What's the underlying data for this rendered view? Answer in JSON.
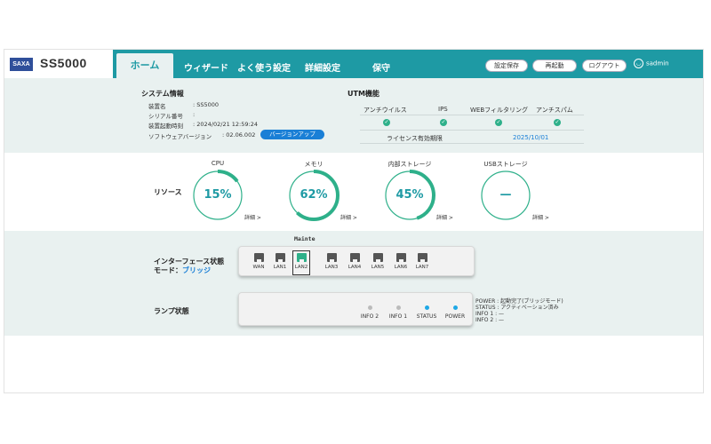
{
  "header": {
    "logo_text": "SAXA",
    "product": "SS5000",
    "tabs": [
      "ホーム",
      "ウィザード",
      "よく使う設定",
      "詳細設定",
      "保守"
    ],
    "buttons": [
      "設定保存",
      "再起動",
      "ログアウト"
    ],
    "user": "sadmin"
  },
  "system": {
    "title": "システム情報",
    "rows": [
      {
        "k": "装置名",
        "v": ": SS5000"
      },
      {
        "k": "シリアル番号",
        "v": ":"
      },
      {
        "k": "装置起動時刻",
        "v": ": 2024/02/21 12:59:24"
      },
      {
        "k": "ソフトウェアバージョン",
        "v": ": 02.06.002"
      }
    ],
    "version_button": "バージョンアップ"
  },
  "utm": {
    "title": "UTM機能",
    "columns": [
      "アンチウイルス",
      "IPS",
      "WEBフィルタリング",
      "アンチスパム"
    ],
    "license_label": "ライセンス有効期限",
    "license_date": "2025/10/01"
  },
  "resource": {
    "title": "リソース",
    "items": [
      {
        "label": "CPU",
        "value": "15%",
        "percent": 15,
        "detail": "詳細 >"
      },
      {
        "label": "メモリ",
        "value": "62%",
        "percent": 62,
        "detail": "詳細 >"
      },
      {
        "label": "内部ストレージ",
        "value": "45%",
        "percent": 45,
        "detail": "詳細 >"
      },
      {
        "label": "USBストレージ",
        "value": "—",
        "percent": 0,
        "detail": "詳細 >"
      }
    ]
  },
  "interface": {
    "title": "インターフェース状態",
    "mode_label": "モード：",
    "mode_value": "ブリッジ",
    "maint_label": "Mainte",
    "ports": [
      "WAN",
      "LAN1",
      "LAN2",
      "LAN3",
      "LAN4",
      "LAN5",
      "LAN6",
      "LAN7"
    ]
  },
  "lamp": {
    "title": "ランプ状態",
    "lamps": [
      {
        "label": "INFO 2",
        "on": false
      },
      {
        "label": "INFO 1",
        "on": false
      },
      {
        "label": "STATUS",
        "on": true
      },
      {
        "label": "POWER",
        "on": true
      }
    ],
    "status_lines": [
      "POWER  : 起動完了(ブリッジモード)",
      "STATUS : アクティベーション済み",
      "INFO 1 : —",
      "INFO 2 : —"
    ]
  },
  "colors": {
    "accent": "#1e9aa4",
    "gauge": "#2eb08a",
    "button_blue": "#1a7fd6"
  }
}
